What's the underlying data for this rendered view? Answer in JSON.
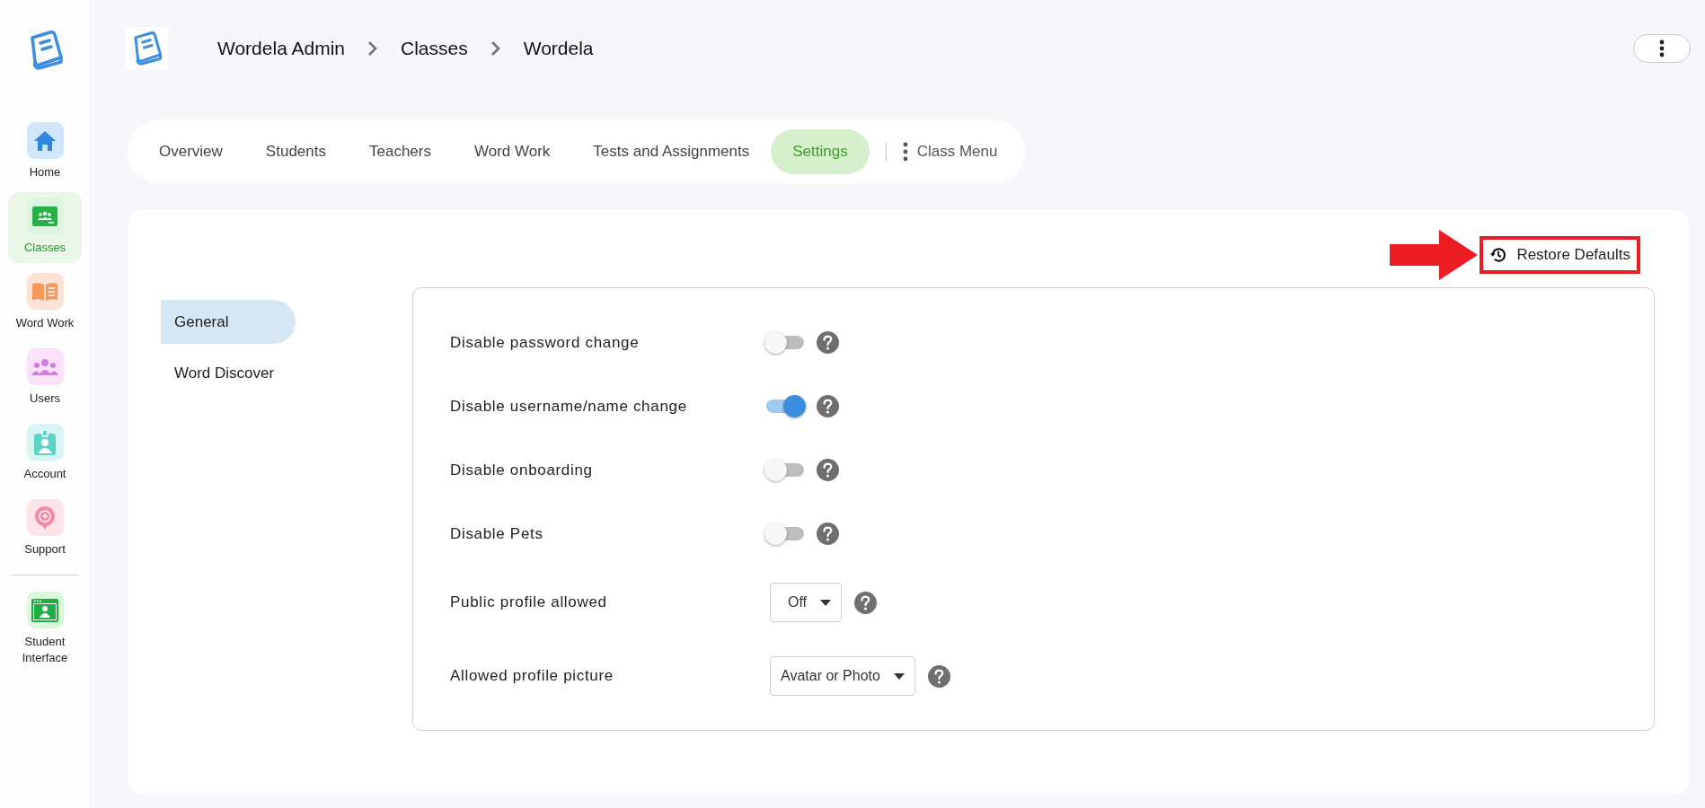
{
  "sidebar": {
    "items": [
      {
        "label": "Home",
        "selected": false
      },
      {
        "label": "Classes",
        "selected": true
      },
      {
        "label": "Word Work",
        "selected": false
      },
      {
        "label": "Users",
        "selected": false
      },
      {
        "label": "Account",
        "selected": false
      },
      {
        "label": "Support",
        "selected": false
      },
      {
        "label": "Student Interface",
        "selected": false
      }
    ]
  },
  "breadcrumb": [
    "Wordela Admin",
    "Classes",
    "Wordela"
  ],
  "tabs": [
    {
      "label": "Overview",
      "selected": false
    },
    {
      "label": "Students",
      "selected": false
    },
    {
      "label": "Teachers",
      "selected": false
    },
    {
      "label": "Word Work",
      "selected": false
    },
    {
      "label": "Tests and Assignments",
      "selected": false
    },
    {
      "label": "Settings",
      "selected": true
    }
  ],
  "class_menu": "Class Menu",
  "restore_button": "Restore Defaults",
  "settings_nav": [
    {
      "label": "General",
      "selected": true
    },
    {
      "label": "Word Discover",
      "selected": false
    }
  ],
  "settings": [
    {
      "kind": "toggle",
      "label": "Disable password change",
      "on": false
    },
    {
      "kind": "toggle",
      "label": "Disable username/name change",
      "on": true
    },
    {
      "kind": "toggle",
      "label": "Disable onboarding",
      "on": false
    },
    {
      "kind": "toggle",
      "label": "Disable Pets",
      "on": false
    },
    {
      "kind": "select",
      "label": "Public profile allowed",
      "value": "Off"
    },
    {
      "kind": "select",
      "label": "Allowed profile picture",
      "value": "Avatar or Photo"
    }
  ]
}
